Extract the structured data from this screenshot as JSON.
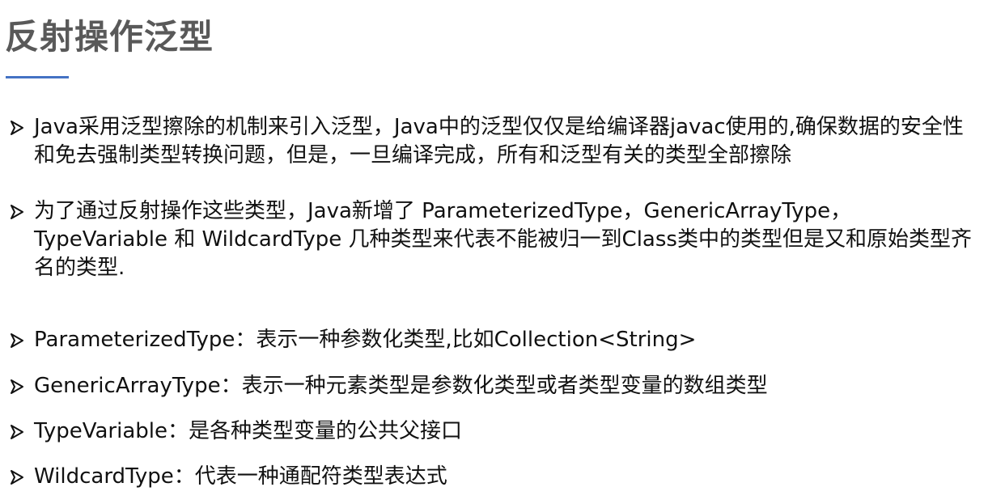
{
  "slide": {
    "title": "反射操作泛型",
    "accent_color": "#4472c4",
    "bullet_icon": "arrowhead-bullet-icon",
    "bullets": [
      {
        "text": "Java采用泛型擦除的机制来引入泛型，Java中的泛型仅仅是给编译器javac使用的,确保数据的安全性和免去强制类型转换问题，但是，一旦编译完成，所有和泛型有关的类型全部擦除"
      },
      {
        "text": "为了通过反射操作这些类型，Java新增了 ParameterizedType，GenericArrayType，TypeVariable 和 WildcardType 几种类型来代表不能被归一到Class类中的类型但是又和原始类型齐名的类型."
      },
      {
        "text": "ParameterizedType：表示一种参数化类型,比如Collection<String>"
      },
      {
        "text": "GenericArrayType：表示一种元素类型是参数化类型或者类型变量的数组类型"
      },
      {
        "text": "TypeVariable：是各种类型变量的公共父接口"
      },
      {
        "text": "WildcardType：代表一种通配符类型表达式"
      }
    ]
  }
}
